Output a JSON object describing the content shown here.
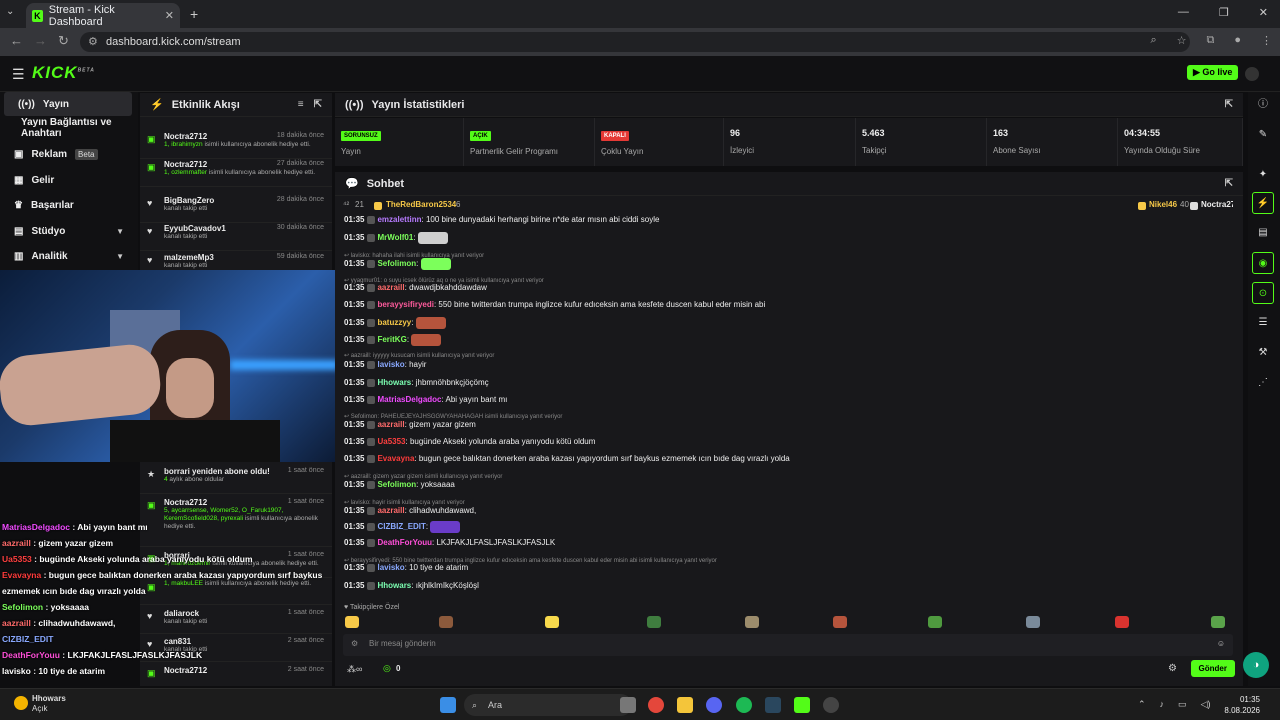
{
  "browser": {
    "tab_title": "Stream - Kick Dashboard",
    "url": "dashboard.kick.com/stream"
  },
  "brand": {
    "logo": "KICK",
    "go_live": "Go live",
    "accent": "#53fc18"
  },
  "sidebar": {
    "items": [
      {
        "label": "Yayın",
        "icon": "broadcast-icon"
      },
      {
        "label": "Yayın Bağlantısı ve Anahtarı",
        "icon": ""
      },
      {
        "label": "Reklam",
        "icon": "ad-icon",
        "badge": "Beta"
      },
      {
        "label": "Gelir",
        "icon": "revenue-icon"
      },
      {
        "label": "Başarılar",
        "icon": "trophy-icon"
      },
      {
        "label": "Stüdyo",
        "icon": "studio-icon"
      },
      {
        "label": "Analitik",
        "icon": "analytics-icon"
      }
    ]
  },
  "activity": {
    "title": "Etkinlik Akışı",
    "items": [
      {
        "name": "Noctra2712",
        "time": "18 dakika önce",
        "desc_hl": "1, ibrahimyzn",
        "desc": " isimli kullanıcıya abonelik hediye etti.",
        "icon": "gift"
      },
      {
        "name": "Noctra2712",
        "time": "27 dakika önce",
        "desc_hl": "1, ozlemmafter",
        "desc": " isimli kullanıcıya abonelik hediye etti.",
        "icon": "gift"
      },
      {
        "name": "BigBangZero",
        "time": "28 dakika önce",
        "desc_hl": "",
        "desc": "kanalı takip etti",
        "icon": "heart"
      },
      {
        "name": "EyyubCavadov1",
        "time": "30 dakika önce",
        "desc_hl": "",
        "desc": "kanalı takip etti",
        "icon": "heart"
      },
      {
        "name": "malzemeMp3",
        "time": "59 dakika önce",
        "desc_hl": "",
        "desc": "kanalı takip etti",
        "icon": "heart"
      },
      {
        "name": "borrari yeniden abone oldu!",
        "time": "1 saat önce",
        "desc_hl": "4",
        "desc": " aylık abone oldular",
        "icon": "star"
      },
      {
        "name": "Noctra2712",
        "time": "1 saat önce",
        "desc_hl": "5, aycarrsense, Womer52, O_Faruk1907, KeremScofield028, pyrexali",
        "desc": " isimli kullanıcıya abonelik hediye etti.",
        "icon": "gift"
      },
      {
        "name": "borrari",
        "time": "1 saat önce",
        "desc_hl": "1, mahirozdemir",
        "desc": " isimli kullanıcıya abonelik hediye etti.",
        "icon": "gift"
      },
      {
        "name": "",
        "time": "",
        "desc_hl": "1, makbuLEE",
        "desc": " isimli kullanıcıya abonelik hediye etti.",
        "icon": "gift"
      },
      {
        "name": "daliarock",
        "time": "1 saat önce",
        "desc_hl": "",
        "desc": "kanalı takip etti",
        "icon": "heart"
      },
      {
        "name": "can831",
        "time": "2 saat önce",
        "desc_hl": "",
        "desc": "kanalı takip etti",
        "icon": "heart"
      },
      {
        "name": "Noctra2712",
        "time": "2 saat önce",
        "desc_hl": "",
        "desc": "",
        "icon": "gift"
      }
    ]
  },
  "overlay_chat": [
    {
      "u": "MatriasDelgadoc",
      "c": "#f04bff",
      "m": "Abi yayın bant mı"
    },
    {
      "u": "aazraill",
      "c": "#ff6b6b",
      "m": "gizem yazar gizem"
    },
    {
      "u": "Ua5353",
      "c": "#ff4040",
      "m": "bugünde Akseki yolunda araba yanıyodu kötü oldum"
    },
    {
      "u": "Evavayna",
      "c": "#ff3b3b",
      "m": "bugun gece balıktan donerken araba kazası yapıyordum sırf baykus"
    },
    {
      "u": "",
      "c": "#fff",
      "m": "ezmemek ıcın bıde dag vırazlı yolda"
    },
    {
      "u": "Sefolimon",
      "c": "#7cff5b",
      "m": "yoksaaaa"
    },
    {
      "u": "aazraill",
      "c": "#ff6b6b",
      "m": "clihadwuhdawawd,"
    },
    {
      "u": "CIZBIZ_EDIT",
      "c": "#8aa9ff",
      "m": ""
    },
    {
      "u": "DeathForYouu",
      "c": "#ff4fd8",
      "m": "LKJFAKJLFASLJFASLKJFASJLK"
    },
    {
      "u": "lavisko",
      "c": "#fff",
      "m": "10 tiye de atarim"
    },
    {
      "u": "Hhowars",
      "c": "#fff",
      "m": "ıkjhlkImIkçKöşlöşl"
    }
  ],
  "stats": {
    "title": "Yayın İstatistikleri",
    "items": [
      {
        "badge": "SORUNSUZ",
        "badge_color": "#53fc18",
        "label": "Yayın"
      },
      {
        "badge": "AÇIK",
        "badge_color": "#53fc18",
        "label": "Partnerlik Gelir Programı"
      },
      {
        "badge": "KAPALI",
        "badge_color": "#e53935",
        "label": "Çoklu Yayın"
      },
      {
        "value": "96",
        "label": "İzleyici"
      },
      {
        "value": "5.463",
        "label": "Takipçi"
      },
      {
        "value": "163",
        "label": "Abone Sayısı"
      },
      {
        "value": "04:34:55",
        "label": "Yayında Olduğu Süre"
      }
    ]
  },
  "chat": {
    "title": "Sohbet",
    "top_chatters": {
      "left_count": "21",
      "left_user": "TheRedBaron2534",
      "left_num": "6",
      "mid_user": "Nikel46",
      "mid_num": "40",
      "right_user": "Noctra2712"
    },
    "lines": [
      {
        "kind": "msg",
        "t": "01:35",
        "u": "emzalettinn",
        "c": "#b77bff",
        "m": "100 bine dunyadaki herhangi birine n*de atar mısın abi ciddi soyle"
      },
      {
        "kind": "msg",
        "t": "01:35",
        "u": "MrWolf01",
        "c": "#7cff5b",
        "m": ""
      },
      {
        "kind": "reply",
        "m": "lavisko: hahaha ilahi isimli kullanıcıya yanıt veriyor"
      },
      {
        "kind": "msg",
        "t": "01:35",
        "u": "Sefolimon",
        "c": "#7cff5b",
        "m": ""
      },
      {
        "kind": "reply",
        "m": "yyagmur01: o suyu icsek ölürüz aq o ne ya isimli kullanıcıya yanıt veriyor"
      },
      {
        "kind": "msg",
        "t": "01:35",
        "u": "aazraill",
        "c": "#ff6b6b",
        "m": "dwawdjbkahddawdaw"
      },
      {
        "kind": "msg",
        "t": "01:35",
        "u": "berayysifiryedi",
        "c": "#ff5b9d",
        "m": "550 bine twitterdan trumpa inglizce kufur edıceksin ama kesfete duscen kabul eder misin abi"
      },
      {
        "kind": "msg",
        "t": "01:35",
        "u": "batuzzyy",
        "c": "#f7c948",
        "m": ""
      },
      {
        "kind": "msg",
        "t": "01:35",
        "u": "FeritKG",
        "c": "#7cff5b",
        "m": ""
      },
      {
        "kind": "reply",
        "m": "aazraill: iyyyyy kusucam isimli kullanıcıya yanıt veriyor"
      },
      {
        "kind": "msg",
        "t": "01:35",
        "u": "lavisko",
        "c": "#8aa9ff",
        "m": "hayir"
      },
      {
        "kind": "msg",
        "t": "01:35",
        "u": "Hhowars",
        "c": "#7cffb2",
        "m": "jhbmnöhbnkçjöçömç"
      },
      {
        "kind": "msg",
        "t": "01:35",
        "u": "MatriasDelgadoc",
        "c": "#f04bff",
        "m": "Abi yayın bant mı"
      },
      {
        "kind": "reply",
        "m": "Sefolimon: PAHEUEJEYAJHSGGWYAHAHAGAH isimli kullanıcıya yanıt veriyor"
      },
      {
        "kind": "msg",
        "t": "01:35",
        "u": "aazraill",
        "c": "#ff6b6b",
        "m": "gizem yazar gizem"
      },
      {
        "kind": "msg",
        "t": "01:35",
        "u": "Ua5353",
        "c": "#ff4040",
        "m": "bugünde Akseki yolunda araba yanıyodu kötü oldum"
      },
      {
        "kind": "msg",
        "t": "01:35",
        "u": "Evavayna",
        "c": "#ff3b3b",
        "m": "bugun gece balıktan donerken araba kazası yapıyordum sırf baykus ezmemek ıcın bıde dag vırazlı yolda"
      },
      {
        "kind": "reply",
        "m": "aazraill: gizem yazar gizem isimli kullanıcıya yanıt veriyor"
      },
      {
        "kind": "msg",
        "t": "01:35",
        "u": "Sefolimon",
        "c": "#7cff5b",
        "m": "yoksaaaa"
      },
      {
        "kind": "reply",
        "m": "lavisko: hayir isimli kullanıcıya yanıt veriyor"
      },
      {
        "kind": "msg",
        "t": "01:35",
        "u": "aazraill",
        "c": "#ff6b6b",
        "m": "clihadwuhdawawd,"
      },
      {
        "kind": "msg",
        "t": "01:35",
        "u": "CIZBIZ_EDIT",
        "c": "#8aa9ff",
        "m": ""
      },
      {
        "kind": "msg",
        "t": "01:35",
        "u": "DeathForYouu",
        "c": "#ff4fd8",
        "m": "LKJFAKJLFASLJFASLKJFASJLK"
      },
      {
        "kind": "reply",
        "m": "berayysifiryedi: 550 bine twitterdan trumpa inglizce kufur edıceksin ama kesfete duscen kabul eder misin abi isimli kullanıcıya yanıt veriyor"
      },
      {
        "kind": "msg",
        "t": "01:35",
        "u": "lavisko",
        "c": "#8aa9ff",
        "m": "10 tiye de atarim"
      },
      {
        "kind": "msg",
        "t": "01:35",
        "u": "Hhowars",
        "c": "#7cffb2",
        "m": "ıkjhlkImIkçKöşlöşl"
      }
    ],
    "favorites_label": "Takipçilere Özel",
    "input_placeholder": "Bir mesaj gönderin",
    "send_label": "Gönder",
    "bottom_count": "0"
  },
  "taskbar": {
    "search": "Ara",
    "weather_label": "Açık",
    "time": "01:35",
    "date": "8.08.2026"
  }
}
